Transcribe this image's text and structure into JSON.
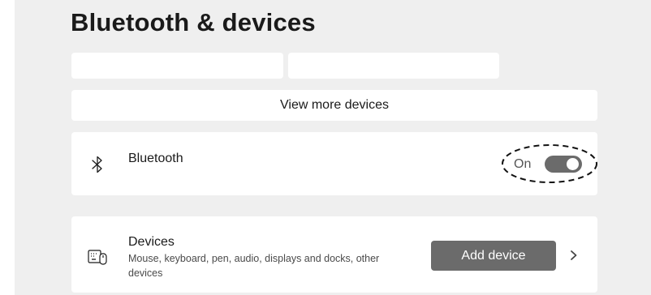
{
  "page": {
    "title": "Bluetooth & devices"
  },
  "view_more_label": "View more devices",
  "bluetooth": {
    "label": "Bluetooth",
    "toggle_state_label": "On",
    "enabled": true,
    "icon": "bluetooth-icon"
  },
  "devices": {
    "title": "Devices",
    "description": "Mouse, keyboard, pen, audio, displays and docks, other devices",
    "add_button_label": "Add device",
    "icon": "keyboard-mouse-icon",
    "chevron_icon": "chevron-right-icon"
  },
  "colors": {
    "background": "#efefef",
    "card": "#ffffff",
    "button": "#6b6b6b",
    "toggle_on": "#6b6b6b"
  }
}
